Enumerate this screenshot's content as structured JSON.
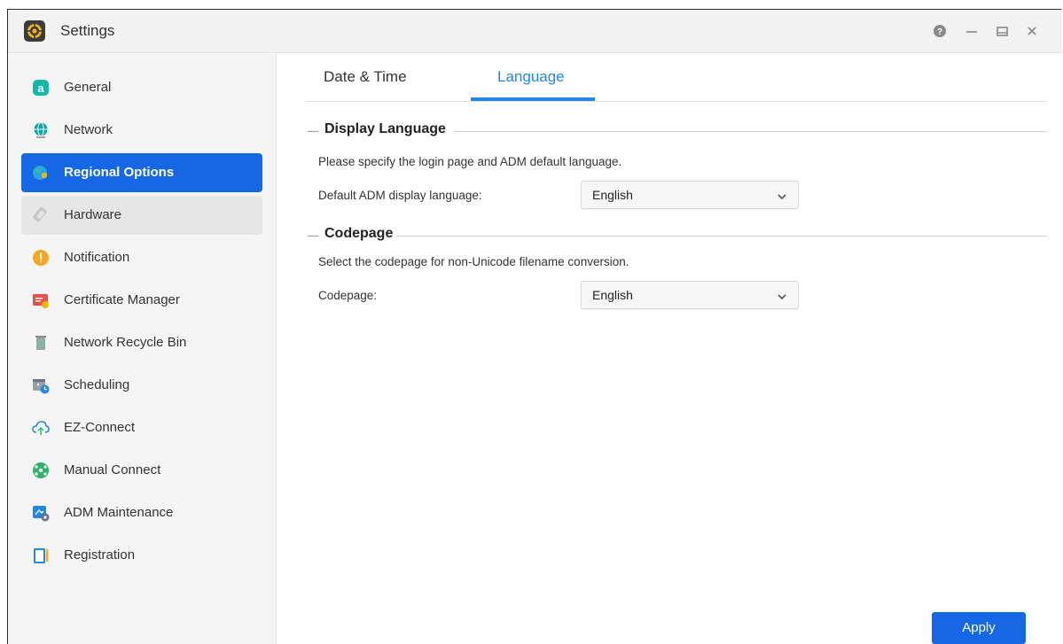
{
  "window": {
    "title": "Settings",
    "controls": [
      "help-icon",
      "minimize-icon",
      "maximize-icon",
      "close-icon"
    ]
  },
  "sidebar": {
    "items": [
      {
        "label": "General",
        "icon": "general-icon"
      },
      {
        "label": "Network",
        "icon": "globe-icon"
      },
      {
        "label": "Regional Options",
        "icon": "regional-globe-icon",
        "active": true
      },
      {
        "label": "Hardware",
        "icon": "hardware-icon",
        "hover": true
      },
      {
        "label": "Notification",
        "icon": "exclamation-icon"
      },
      {
        "label": "Certificate Manager",
        "icon": "certificate-icon"
      },
      {
        "label": "Network Recycle Bin",
        "icon": "recycle-bin-icon"
      },
      {
        "label": "Scheduling",
        "icon": "calendar-clock-icon"
      },
      {
        "label": "EZ-Connect",
        "icon": "cloud-upload-icon"
      },
      {
        "label": "Manual Connect",
        "icon": "manual-connect-icon"
      },
      {
        "label": "ADM Maintenance",
        "icon": "maintenance-icon"
      },
      {
        "label": "Registration",
        "icon": "registration-icon"
      }
    ]
  },
  "tabs": [
    {
      "label": "Date & Time"
    },
    {
      "label": "Language",
      "active": true
    }
  ],
  "display_language": {
    "title": "Display Language",
    "description": "Please specify the login page and ADM default language.",
    "field_label": "Default ADM display language:",
    "value": "English"
  },
  "codepage": {
    "title": "Codepage",
    "description": "Select the codepage for non-Unicode filename conversion.",
    "field_label": "Codepage:",
    "value": "English"
  },
  "footer": {
    "apply_label": "Apply"
  },
  "colors": {
    "accent": "#1667e6",
    "tab_active": "#1e88e5"
  }
}
